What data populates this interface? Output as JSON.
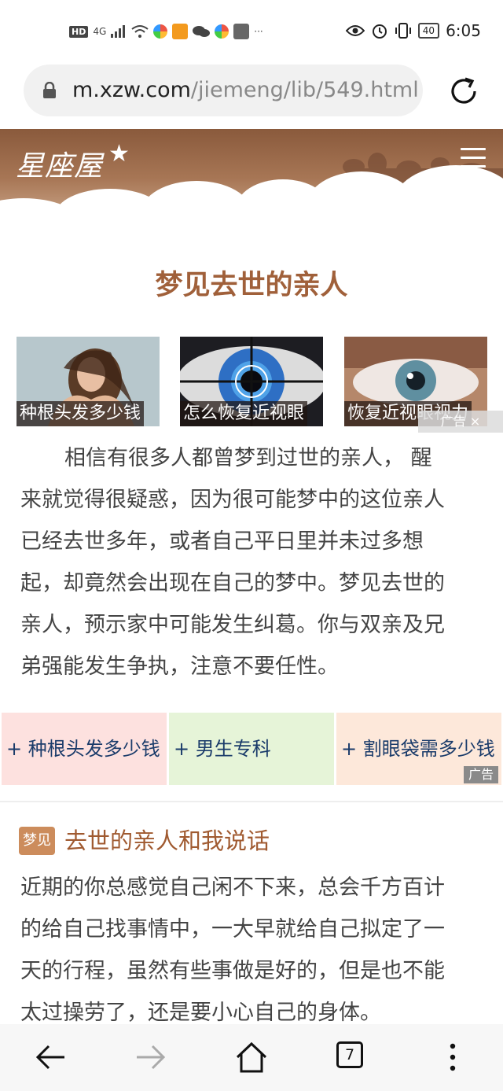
{
  "status_bar": {
    "signal": "4G",
    "hd": "HD",
    "battery": "40",
    "time": "6:05",
    "more": "···"
  },
  "browser": {
    "url_host": "m.xzw.com",
    "url_path": "/jiemeng/lib/549.html?",
    "tab_count": "7"
  },
  "site": {
    "logo": "星座屋"
  },
  "article": {
    "title": "梦见去世的亲人",
    "thumbnails": [
      {
        "caption": "种根头发多少钱"
      },
      {
        "caption": "怎么恢复近视眼"
      },
      {
        "caption": "恢复近视眼视力"
      }
    ],
    "ad_tag": "广告 ×",
    "paragraph_lines": [
      "相信有很多人都曾梦到过世的亲人， 醒",
      "来就觉得很疑惑，因为很可能梦中的这位亲人",
      "已经去世多年，或者自己平日里并未过多想",
      "起，却竟然会出现在自己的梦中。梦见去世的",
      "亲人，预示家中可能发生纠葛。你与双亲及兄",
      "弟强能发生争执，注意不要任性。"
    ]
  },
  "link_boxes": [
    {
      "label": "+ 种根头发多少钱"
    },
    {
      "label": "+ 男生专科"
    },
    {
      "label": "+ 割眼袋需多少钱"
    }
  ],
  "link_ad_label": "广告",
  "section": {
    "badge": "梦见",
    "title": "去世的亲人和我说话",
    "lines": [
      "近期的你总感觉自己闲不下来，总会千方百计",
      "的给自己找事情中，一大早就给自己拟定了一",
      "天的行程，虽然有些事做是好的，但是也不能",
      "太过操劳了，还是要小心自己的身体。"
    ]
  },
  "colors": {
    "title": "#a0603a",
    "header_brown": "#8a5a3c",
    "link_box_1": "#fde1df",
    "link_box_2": "#e6f4d8",
    "link_box_3": "#fde8da",
    "link_text": "#1a3b6a"
  }
}
